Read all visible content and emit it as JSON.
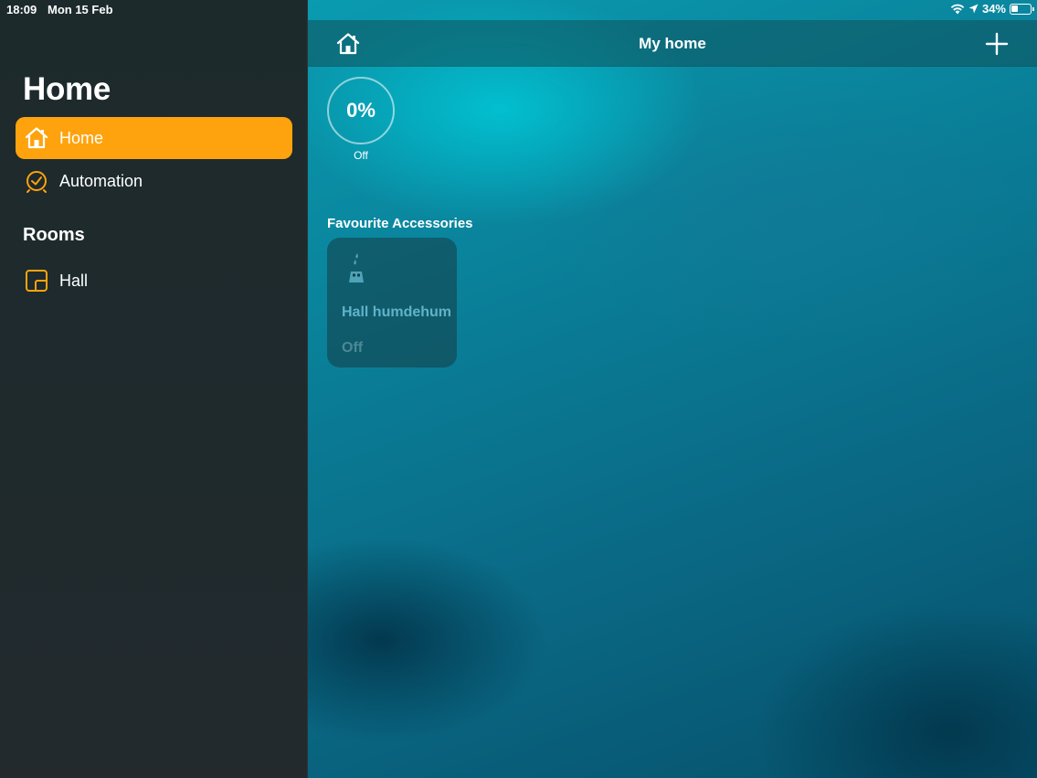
{
  "status_bar": {
    "time": "18:09",
    "date": "Mon 15 Feb",
    "battery": "34%",
    "icons": [
      "wifi-icon",
      "location-arrow-icon",
      "battery-icon"
    ]
  },
  "sidebar": {
    "title": "Home",
    "nav": [
      {
        "label": "Home",
        "icon": "house-icon",
        "active": true
      },
      {
        "label": "Automation",
        "icon": "clock-icon",
        "active": false
      }
    ],
    "rooms_title": "Rooms",
    "rooms": [
      {
        "label": "Hall",
        "icon": "room-icon"
      }
    ]
  },
  "main": {
    "title": "My home",
    "home_button_icon": "house-icon",
    "add_button_icon": "plus-icon",
    "status": {
      "value": "0%",
      "label": "Off"
    },
    "favourites_title": "Favourite Accessories",
    "favourites": [
      {
        "name": "Hall humdehum",
        "status": "Off",
        "icon": "dehumidifier-icon"
      }
    ]
  },
  "colors": {
    "accent": "#fea30d",
    "sidebar_bg": "#1f2a2d",
    "tile_text": "#5fb3c8"
  }
}
